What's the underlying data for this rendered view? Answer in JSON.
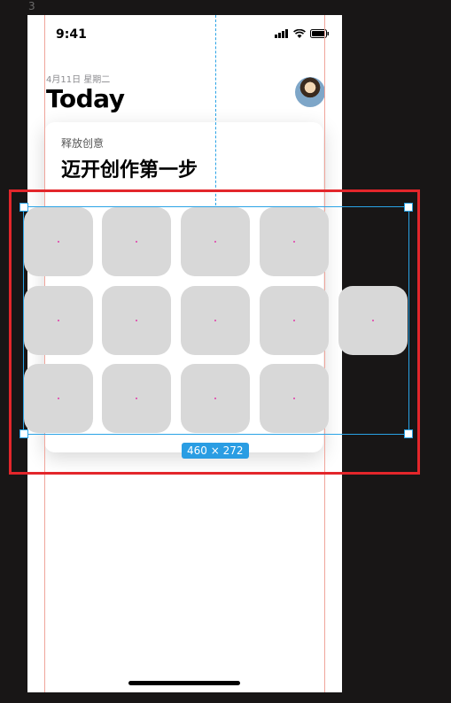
{
  "artboard": {
    "label": "3"
  },
  "status_bar": {
    "time": "9:41"
  },
  "header": {
    "date": "4月11日 星期二",
    "title": "Today"
  },
  "card": {
    "subtitle": "释放创意",
    "title": "迈开创作第一步"
  },
  "selection": {
    "size_label": "460 × 272"
  },
  "colors": {
    "canvas_bg": "#181616",
    "guide": "#f0a59b",
    "selection": "#2aa3e6",
    "highlight": "#e3262b",
    "tile": "#d8d8d8"
  }
}
